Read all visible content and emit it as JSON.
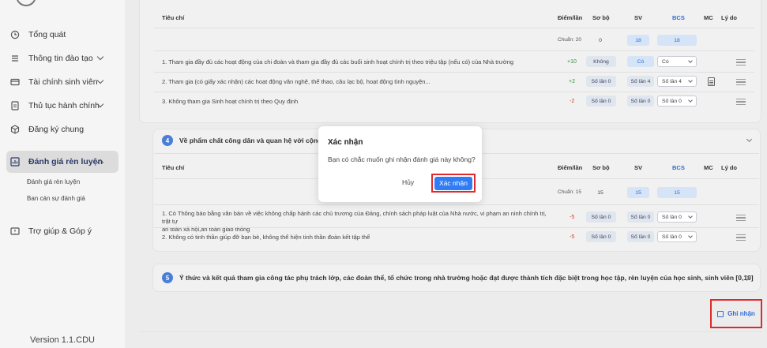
{
  "sidebar": {
    "items": [
      {
        "label": "Tổng quát",
        "icon": "clock-icon",
        "chevron": ""
      },
      {
        "label": "Thông tin đào tạo",
        "icon": "list-icon",
        "chevron": "down"
      },
      {
        "label": "Tài chính sinh viên",
        "icon": "card-icon",
        "chevron": "down"
      },
      {
        "label": "Thủ tục hành chính",
        "icon": "document-icon",
        "chevron": "down"
      },
      {
        "label": "Đăng ký chung",
        "icon": "box-icon",
        "chevron": ""
      },
      {
        "label": "Đánh giá rèn luyện",
        "icon": "chart-icon",
        "chevron": "up"
      },
      {
        "label": "Trợ giúp & Góp ý",
        "icon": "help-icon",
        "chevron": ""
      }
    ],
    "subitems": [
      "Đánh giá rèn luyện",
      "Ban cán sự đánh giá"
    ],
    "version": "Version 1.1.CDU"
  },
  "headers": {
    "tieu_chi": "Tiêu chí",
    "diem_lan": "Điểm/lần",
    "so_bo": "Sơ bộ",
    "sv": "SV",
    "bcs": "BCS",
    "mc": "MC",
    "ly_do": "Lý do"
  },
  "section3": {
    "chuan": "Chuẩn: 20",
    "so_bo": "0",
    "sv": "18",
    "bcs": "18",
    "rows": [
      {
        "text": "1. Tham gia đầy đủ các hoạt động của chi đoàn và tham gia đầy đủ các buổi sinh hoạt chính trị theo triệu tập (nếu có) của Nhà trường",
        "score": "+10",
        "so_bo": "Không",
        "sv": "Có",
        "bcs": "Có"
      },
      {
        "text": "2. Tham gia (có giấy xác nhận) các hoạt động văn nghệ, thể thao, câu lạc bộ, hoạt động tình nguyện...",
        "score": "+2",
        "so_bo": "Số lần 0",
        "sv": "Số lần 4",
        "bcs": "Số lần 4"
      },
      {
        "text": "3. Không tham gia Sinh hoạt chính trị theo Quy định",
        "score": "-2",
        "so_bo": "Số lần 0",
        "sv": "Số lần 0",
        "bcs": "Số lần 0"
      }
    ]
  },
  "section4": {
    "num": "4",
    "title": "Về phẩm chất công dân và quan hệ với cộng đồ",
    "chuan": "Chuẩn: 15",
    "so_bo": "15",
    "sv": "15",
    "bcs": "15",
    "rows": [
      {
        "text1": "1. Có Thông báo bằng văn bản về việc không chấp hành các chủ trương của Đảng, chính sách pháp luật của Nhà nước, vi phạm an ninh chính trị, trật tự",
        "text2": "an toàn xã hội,an toàn giao thông",
        "score": "-5",
        "so_bo": "Số lần 0",
        "sv": "Số lần 0",
        "bcs": "Số lần 0"
      },
      {
        "text": "2. Không có tinh thần giúp đỡ bạn bè, không thể hiện tinh thần đoàn kết tập thể",
        "score": "-5",
        "so_bo": "Số lần 0",
        "sv": "Số lần 0",
        "bcs": "Số lần 0"
      }
    ]
  },
  "section5": {
    "num": "5",
    "title": "Ý thức và kết quả tham gia công tác phụ trách lớp, các đoàn thể, tổ chức trong nhà trường hoặc đạt được thành tích đặc biệt trong học tập, rèn luyện của học sinh, sinh viên [0,10]"
  },
  "dialog": {
    "title": "Xác nhận",
    "message": "Bạn có chắc muốn ghi nhận đánh giá này không?",
    "cancel": "Hủy",
    "confirm": "Xác nhận"
  },
  "save_label": "Ghi nhận",
  "colors": {
    "accent": "#2f7cf6",
    "highlight": "#e02a2a",
    "badge": "#4a7fd6"
  }
}
